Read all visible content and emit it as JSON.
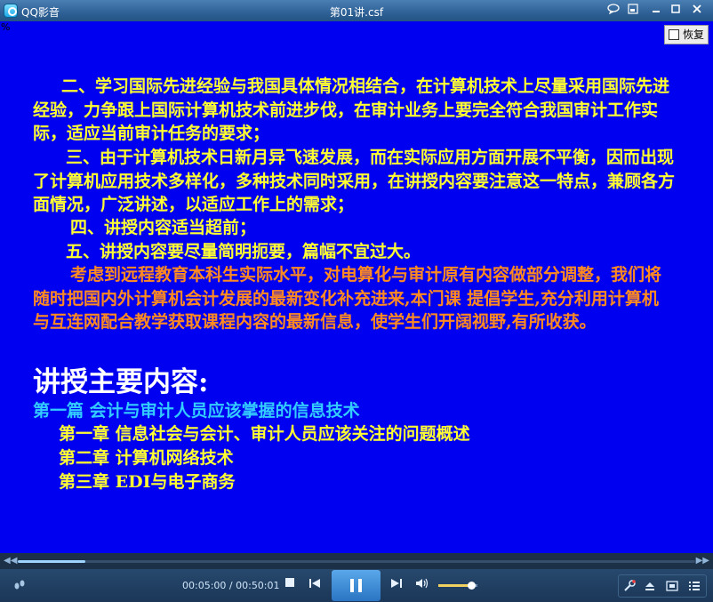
{
  "window": {
    "app_name": "QQ影音",
    "file_title": "第01讲.csf",
    "chat_icon": "chat-icon",
    "mini_icon": "mini-mode-icon",
    "min_icon": "minimize-icon",
    "max_icon": "maximize-icon",
    "close_icon": "close-icon"
  },
  "video": {
    "restore_label": "恢复",
    "corner_mark": "%"
  },
  "slide": {
    "paragraphs_yellow": [
      "二、学习国际先进经验与我国具体情况相结合，在计算机技术上尽量采用国际先进经验，力争跟上国际计算机技术前进步伐，在审计业务上要完全符合我国审计工作实际，适应当前审计任务的要求；",
      "三、由于计算机技术日新月异飞速发展，而在实际应用方面开展不平衡，因而出现了计算机应用技术多样化，多种技术同时采用，在讲授内容要注意这一特点，兼顾各方面情况，广泛讲述，以适应工作上的需求；",
      "四、讲授内容适当超前；",
      "五、讲授内容要尽量简明扼要，篇幅不宜过大。"
    ],
    "paragraph_orange": "考虑到远程教育本科生实际水平，对电算化与审计原有内容做部分调整，我们将随时把国内外计算机会计发展的最新变化补充进来,本门课 提倡学生,充分利用计算机与互连网配合教学获取课程内容的最新信息，使学生们开阔视野,有所收获。",
    "heading": "讲授主要内容:",
    "section": "第一篇   会计与审计人员应该掌握的信息技术",
    "chapters": [
      "第一章  信息社会与会计、审计人员应该关注的问题概述",
      "第二章  计算机网络技术",
      "第三章  EDI与电子商务"
    ],
    "colors": {
      "background": "#0000f0",
      "yellow_text": "#ffff33",
      "orange_text": "#ff8a22",
      "heading_text": "#ffffff",
      "section_text": "#33ccff"
    }
  },
  "player": {
    "time_current": "00:05:00",
    "time_separator": " / ",
    "time_total": "00:50:01",
    "progress_fraction": 0.1,
    "volume_fraction": 0.85,
    "play_state": "playing",
    "icons": {
      "footprint": "footprint-icon",
      "stop": "stop-icon",
      "prev": "previous-icon",
      "pause": "pause-icon",
      "next": "next-icon",
      "volume": "volume-icon",
      "tools": "tools-icon",
      "eject": "eject-icon",
      "screen": "screen-icon",
      "playlist": "playlist-icon"
    }
  }
}
